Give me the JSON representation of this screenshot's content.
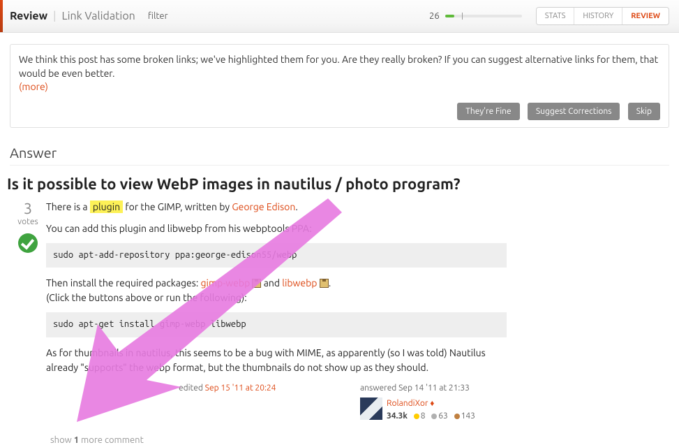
{
  "topbar": {
    "title_main": "Review",
    "title_sub": "Link Validation",
    "filter_label": "filter",
    "progress_count": "26",
    "btn_stats": "STATS",
    "btn_history": "HISTORY",
    "btn_review": "REVIEW"
  },
  "notice": {
    "text": "We think this post has some broken links; we've highlighted them for you. Are they really broken? If you can suggest alternative links for them, that would be even better.",
    "more": "(more)",
    "btn_fine": "They're Fine",
    "btn_suggest": "Suggest Corrections",
    "btn_skip": "Skip"
  },
  "section_header": "Answer",
  "question_title": "Is it possible to view WebP images in nautilus / photo program?",
  "vote": {
    "count": "3",
    "label": "votes"
  },
  "post": {
    "p1a": "There is a ",
    "p1_plugin": "plugin",
    "p1b": " for the GIMP, written by ",
    "p1_author": "George Edison",
    "p1c": ".",
    "p2": "You can add this plugin and libwebp from his webptools PPA:",
    "code1": "sudo apt-add-repository ppa:george-edison55/webp",
    "p3a": "Then install the required packages: ",
    "pkg1": "gimp-webp",
    "p3b": " and ",
    "pkg2": "libwebp",
    "p3c": ".",
    "p4": "(Click the buttons above or run the following):",
    "code2": "sudo apt-get install gimp-webp libwebp",
    "p5": "As for thumbnails in nautilus, this seems to be a bug with MIME, as apparently (so I was told) Nautilus already \"supports\" the webp format, but the thumbnails do not show up as they should."
  },
  "edited": {
    "prefix": "edited ",
    "date": "Sep 15 '11 at 20:24"
  },
  "answered": {
    "prefix": "answered ",
    "date": "Sep 14 '11 at 21:33",
    "user": "RolandiXor",
    "diamond": "♦",
    "rep": "34.3k",
    "gold": "8",
    "silver": "63",
    "bronze": "143"
  },
  "more_comments": {
    "a": "show ",
    "n": "1",
    "b": " more comment"
  }
}
